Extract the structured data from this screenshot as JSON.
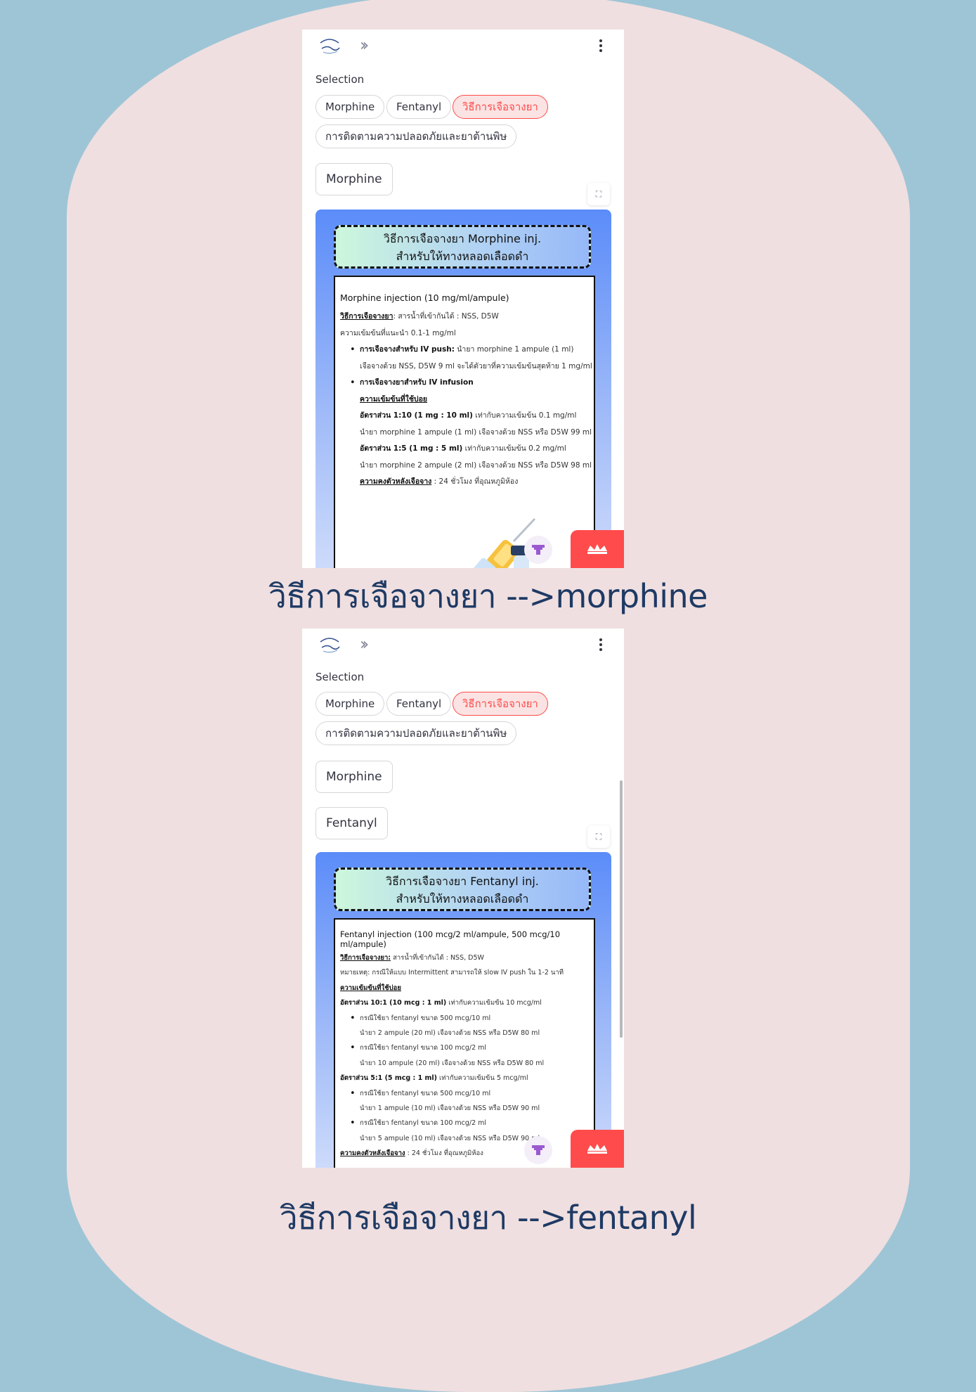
{
  "colors": {
    "page_bg": "#9ec5d6",
    "blob": "#f0dfe0",
    "accent": "#ff4b4b",
    "caption": "#1e3a64"
  },
  "icons": [
    "logo-icon",
    "expand-sidebar-icon",
    "kebab-menu-icon",
    "fullscreen-icon",
    "syringe-icon",
    "streamlit-fab-icon",
    "crown-icon"
  ],
  "screen1": {
    "selection_label": "Selection",
    "pills": [
      "Morphine",
      "Fentanyl",
      "วิธีการเจือจางยา",
      "การติดตามความปลอดภัยและยาต้านพิษ"
    ],
    "active_pill": "วิธีการเจือจางยา",
    "buttons": [
      "Morphine"
    ],
    "card_title_1": "วิธีการเจือจางยา Morphine inj.",
    "card_title_2": "สำหรับให้ทางหลอดเลือดดำ",
    "body_title": "Morphine injection (10 mg/ml/ampule)",
    "l1_label": "วิธีการเจือจางยา",
    "l1_text": ": สารน้ำที่เข้ากันได้ : NSS, D5W",
    "l2": "ความเข้มข้นที่แนะนำ 0.1-1 mg/ml",
    "b1_bold": "การเจือจางสำหรับ IV push:",
    "b1_text": " นำยา morphine 1 ampule (1 ml)",
    "b1_cont": "เจือจางด้วย NSS, D5W 9 ml จะได้ตัวยาที่ความเข้มข้นสุดท้าย 1 mg/ml",
    "b2_bold": "การเจือจางยาสำหรับ IV infusion",
    "common_conc": "ความเข้มข้นที่ใช้บ่อย",
    "r1_bold": "อัตราส่วน 1:10 (1 mg : 10 ml)",
    "r1_text": " เท่ากับความเข้มข้น 0.1 mg/ml",
    "r1_cont": "นำยา morphine 1 ampule (1 ml) เจือจางด้วย NSS หรือ D5W 99 ml",
    "r2_bold": "อัตราส่วน 1:5 (1 mg : 5 ml)",
    "r2_text": " เท่ากับความเข้มข้น 0.2 mg/ml",
    "r2_cont": "นำยา morphine 2 ampule (2 ml) เจือจางด้วย NSS หรือ D5W 98 ml",
    "stab_label": "ความคงตัวหลังเจือจาง",
    "stab_text": " : 24 ชั่วโมง ที่อุณหภูมิห้อง"
  },
  "caption1": "วิธีการเจือจางยา -->morphine",
  "screen2": {
    "selection_label": "Selection",
    "pills": [
      "Morphine",
      "Fentanyl",
      "วิธีการเจือจางยา",
      "การติดตามความปลอดภัยและยาต้านพิษ"
    ],
    "active_pill": "วิธีการเจือจางยา",
    "buttons": [
      "Morphine",
      "Fentanyl"
    ],
    "card_title_1": "วิธีการเจือจางยา Fentanyl inj.",
    "card_title_2": "สำหรับให้ทางหลอดเลือดดำ",
    "body_title": "Fentanyl injection (100 mcg/2 ml/ampule, 500 mcg/10 ml/ampule)",
    "l1_label": "วิธีการเจือจางยา:",
    "l1_text": " สารน้ำที่เข้ากันได้ : NSS, D5W",
    "note": "หมายเหตุ: กรณีให้แบบ Intermittent สามารถให้ slow IV push ใน 1-2 นาที",
    "common_conc": "ความเข้มข้นที่ใช้บ่อย",
    "r1_bold": "อัตราส่วน 10:1 (10 mcg : 1 ml)",
    "r1_text": " เท่ากับความเข้มข้น 10 mcg/ml",
    "r1_b1": "กรณีใช้ยา fentanyl ขนาด 500 mcg/10 ml",
    "r1_b1_cont": "นำยา 2 ampule (20 ml) เจือจางด้วย NSS หรือ D5W 80 ml",
    "r1_b2": "กรณีใช้ยา fentanyl ขนาด 100 mcg/2 ml",
    "r1_b2_cont": "นำยา 10 ampule (20 ml) เจือจางด้วย NSS หรือ D5W 80 ml",
    "r2_bold": "อัตราส่วน 5:1 (5 mcg : 1 ml)",
    "r2_text": " เท่ากับความเข้มข้น 5 mcg/ml",
    "r2_b1": "กรณีใช้ยา fentanyl ขนาด 500 mcg/10 ml",
    "r2_b1_cont": "นำยา 1 ampule (10 ml) เจือจางด้วย NSS หรือ D5W 90 ml",
    "r2_b2": "กรณีใช้ยา fentanyl ขนาด 100 mcg/2 ml",
    "r2_b2_cont": "นำยา 5 ampule (10 ml) เจือจางด้วย NSS หรือ D5W 90 ml",
    "stab_label": "ความคงตัวหลังเจือจาง",
    "stab_text": " : 24 ชั่วโมง ที่อุณหภูมิห้อง"
  },
  "caption2": "วิธีการเจือจางยา -->fentanyl"
}
